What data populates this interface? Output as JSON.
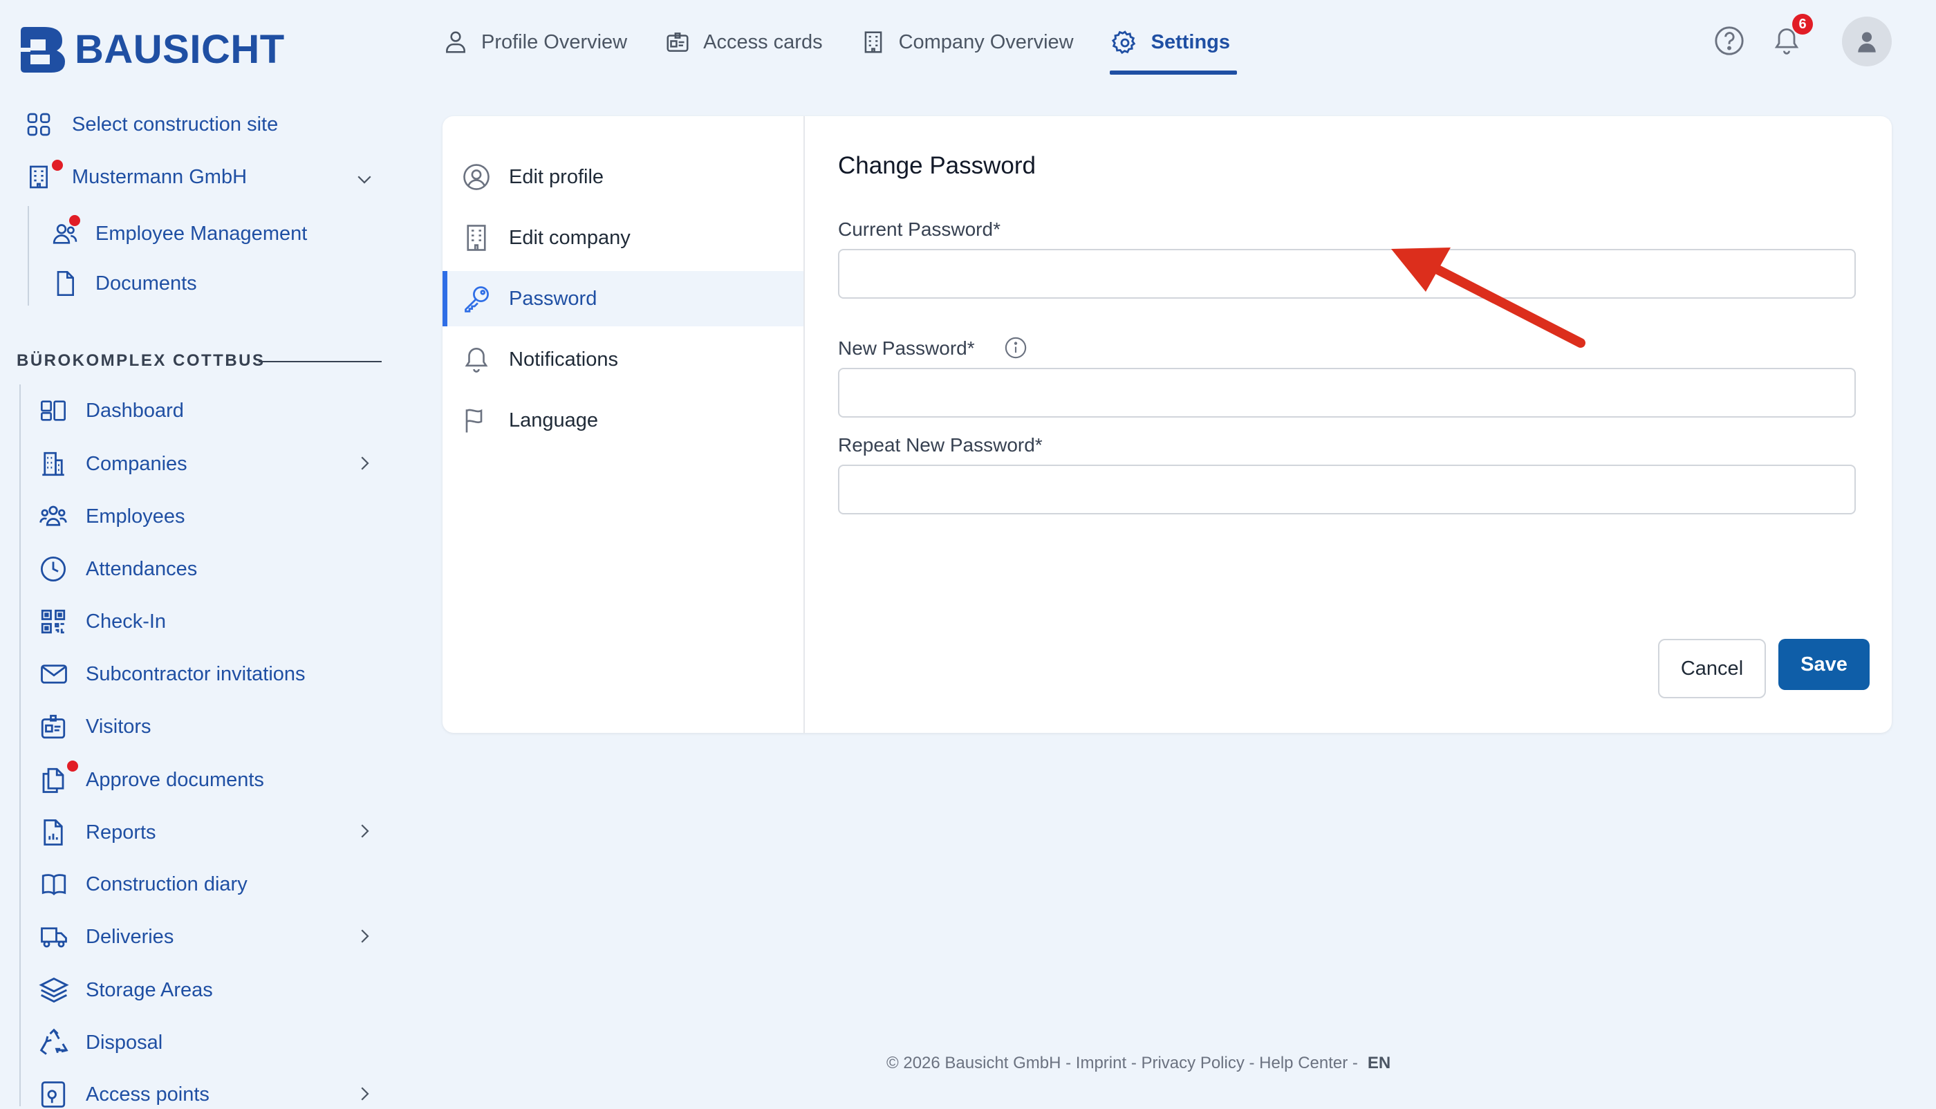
{
  "app": {
    "name": "BAUSICHT",
    "brand_color": "#1f4fa3",
    "accent_red": "#e11d26"
  },
  "topnav": {
    "tabs": [
      {
        "label": "Profile Overview",
        "icon": "user-icon"
      },
      {
        "label": "Access cards",
        "icon": "id-card-icon"
      },
      {
        "label": "Company Overview",
        "icon": "building-icon"
      },
      {
        "label": "Settings",
        "icon": "gear-icon",
        "active": true
      }
    ],
    "notifications_count": "6"
  },
  "sidebar": {
    "select_site": "Select construction site",
    "company": "Mustermann GmbH",
    "company_items": [
      {
        "label": "Employee Management",
        "icon": "users-icon"
      },
      {
        "label": "Documents",
        "icon": "document-icon"
      }
    ],
    "section_title": "BÜROKOMPLEX COTTBUS",
    "items": [
      {
        "label": "Dashboard",
        "icon": "dashboard-icon"
      },
      {
        "label": "Companies",
        "icon": "building-icon"
      },
      {
        "label": "Employees",
        "icon": "users-icon"
      },
      {
        "label": "Attendances",
        "icon": "clock-icon"
      },
      {
        "label": "Check-In",
        "icon": "qr-code-icon"
      },
      {
        "label": "Subcontractor invitations",
        "icon": "mail-icon"
      },
      {
        "label": "Visitors",
        "icon": "visitor-card-icon"
      },
      {
        "label": "Approve documents",
        "icon": "documents-icon"
      },
      {
        "label": "Reports",
        "icon": "report-icon"
      },
      {
        "label": "Construction diary",
        "icon": "book-icon"
      },
      {
        "label": "Deliveries",
        "icon": "truck-icon"
      },
      {
        "label": "Storage Areas",
        "icon": "layers-icon"
      },
      {
        "label": "Disposal",
        "icon": "recycle-icon"
      },
      {
        "label": "Access points",
        "icon": "access-point-icon"
      }
    ]
  },
  "settings_menu": {
    "items": [
      {
        "label": "Edit profile",
        "icon": "user-circle-icon"
      },
      {
        "label": "Edit company",
        "icon": "building-icon"
      },
      {
        "label": "Password",
        "icon": "key-icon",
        "active": true
      },
      {
        "label": "Notifications",
        "icon": "bell-icon"
      },
      {
        "label": "Language",
        "icon": "flag-icon"
      }
    ]
  },
  "form": {
    "title": "Change Password",
    "current_label": "Current Password*",
    "current_value": "",
    "new_label": "New Password*",
    "new_value": "",
    "repeat_label": "Repeat New Password*",
    "repeat_value": "",
    "cancel_label": "Cancel",
    "save_label": "Save"
  },
  "footer": {
    "text": "© 2026 Bausicht GmbH - Imprint - Privacy Policy - Help Center -",
    "lang": "EN"
  }
}
